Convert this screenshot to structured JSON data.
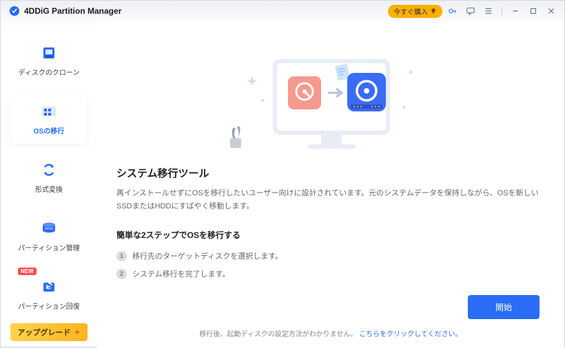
{
  "titlebar": {
    "app_title": "4DDiG Partition Manager",
    "buy_label": "今すぐ購入"
  },
  "sidebar": {
    "items": [
      {
        "label": "ディスクのクローン"
      },
      {
        "label": "OSの移行"
      },
      {
        "label": "形式変換"
      },
      {
        "label": "パーティション管理"
      },
      {
        "label": "パーティション回復",
        "badge": "NEW"
      }
    ],
    "upgrade_label": "アップグレード"
  },
  "main": {
    "heading": "システム移行ツール",
    "description": "再インストールせずにOSを移行したいユーザー向けに設計されています。元のシステムデータを保持しながら、OSを新しいSSDまたはHDDにすばやく移動します。",
    "subheading": "簡単な2ステップでOSを移行する",
    "steps": [
      "移行先のターゲットディスクを選択します。",
      "システム移行を完了します。"
    ],
    "start_label": "開始",
    "footer_text": "移行後、起動ディスクの設定方法がわかりません。",
    "footer_link": "こちらをクリックしてください。"
  },
  "icons": {
    "disk_clone": "disk-clone-icon",
    "os_migrate": "os-migrate-icon",
    "format": "format-convert-icon",
    "partition_mgmt": "partition-mgmt-icon",
    "partition_recover": "partition-recover-icon"
  },
  "colors": {
    "accent": "#2a6cf5",
    "upgrade": "#ffb321"
  }
}
